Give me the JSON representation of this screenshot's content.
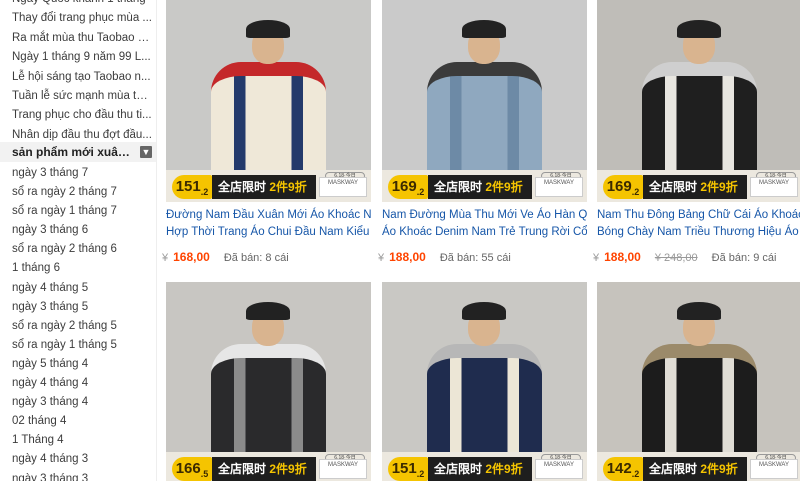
{
  "sidebar": {
    "top_items": [
      "Ngày Quốc khánh 1 tháng",
      "Thay đổi trang phục mùa ...",
      "Ra mắt mùa thu Taobao g...",
      "Ngày 1 tháng 9 năm 99 L...",
      "Lễ hội sáng tạo Taobao n...",
      "Tuần lễ sức mạnh mùa th...",
      "Trang phục cho đầu thu ti...",
      "Nhân dịp đầu thu đợt đầu..."
    ],
    "active_item": "sản phẩm mới xuân hè...",
    "sub_items": [
      "ngày 3 tháng 7",
      "sổ ra ngày 2 tháng 7",
      "sổ ra ngày 1 tháng 7",
      "ngày 3 tháng 6",
      "sổ ra ngày 2 tháng 6",
      "1 tháng 6",
      "ngày 4 tháng 5",
      "ngày 3 tháng 5",
      "sổ ra ngày 2 tháng 5",
      "sổ ra ngày 1 tháng 5",
      "ngày 5 tháng 4",
      "ngày 4 tháng 4",
      "ngày 3 tháng 4",
      "02 tháng 4",
      "1 Tháng 4",
      "ngày 4 tháng 3",
      "ngày 3 tháng 3"
    ]
  },
  "promo": {
    "banner_text": "全店限时",
    "banner_highlight": "2件9折",
    "brand_logo": "MASKWAY",
    "badge": "6.18·今日"
  },
  "products": [
    {
      "promo_price": "151",
      "promo_price_decimal": ".2",
      "title_line1": "Đường Nam Đầu Xuân Mới Áo Khoác Nam",
      "title_line2": "Hợp Thời Trang Áo Chui Đầu Nam Kiểu Mỹ",
      "currency": "¥",
      "price": "168,00",
      "old_price": "",
      "sold": "Đã bán: 8 cái",
      "colors": {
        "bg": "#c9c9c7",
        "torso": "#efe8d8",
        "accent": "#243a6b",
        "accent2": "#c4282a"
      }
    },
    {
      "promo_price": "169",
      "promo_price_decimal": ".2",
      "title_line1": "Nam Đường Mùa Thu Mới Ve Áo Hàn Quốc",
      "title_line2": "Áo Khoác Denim Nam Trẻ Trung Rời Cổ Hợp",
      "currency": "¥",
      "price": "188,00",
      "old_price": "",
      "sold": "Đã bán: 55 cái",
      "colors": {
        "bg": "#cacaca",
        "torso": "#8fa8bf",
        "accent": "#6d8aa6",
        "accent2": "#3b3b3b"
      }
    },
    {
      "promo_price": "169",
      "promo_price_decimal": ".2",
      "title_line1": "Nam Thu Đông Bảng Chữ Cái Áo Khoác",
      "title_line2": "Bóng Chày Nam Triều Thương Hiệu Áo",
      "currency": "¥",
      "price": "188,00",
      "old_price": "248,00",
      "sold": "Đã bán: 9 cái",
      "colors": {
        "bg": "#bfbdb8",
        "torso": "#1f1f1f",
        "accent": "#e8e6e0",
        "accent2": "#cfcfcf"
      }
    },
    {
      "promo_price": "166",
      "promo_price_decimal": ".5",
      "colors": {
        "bg": "#c8c6c2",
        "torso": "#2a2a2c",
        "accent": "#8b8b8b",
        "accent2": "#e6e6e6"
      }
    },
    {
      "promo_price": "151",
      "promo_price_decimal": ".2",
      "colors": {
        "bg": "#c9c8c4",
        "torso": "#1f2c4e",
        "accent": "#ece6d6",
        "accent2": "#b7b7b7"
      }
    },
    {
      "promo_price": "142",
      "promo_price_decimal": ".2",
      "colors": {
        "bg": "#c6c3bd",
        "torso": "#1c1c1c",
        "accent": "#e0ddd5",
        "accent2": "#9b8a6a"
      }
    }
  ]
}
